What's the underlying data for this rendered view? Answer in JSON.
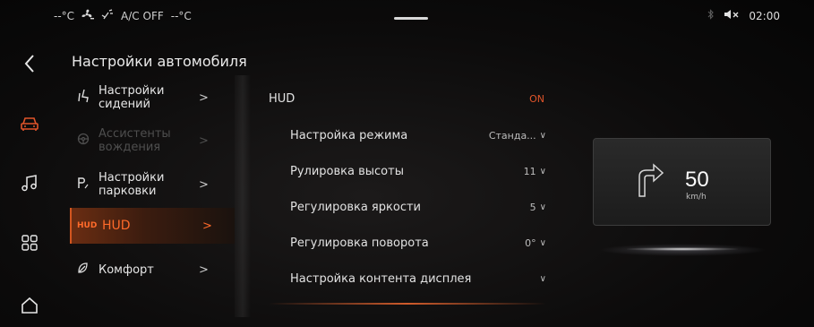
{
  "status_bar": {
    "temp_left": "--°C",
    "fan_icon": "fan-icon",
    "airflow_icon": "airflow-icon",
    "ac_label": "A/C OFF",
    "temp_right": "--°C",
    "bluetooth_icon": "bluetooth-icon",
    "mute_icon": "volume-mute-icon",
    "time": "02:00"
  },
  "nav": {
    "back_icon": "back-arrow-icon",
    "items": [
      {
        "icon": "car-icon",
        "active": true
      },
      {
        "icon": "music-icon",
        "active": false
      },
      {
        "icon": "apps-grid-icon",
        "active": false
      },
      {
        "icon": "home-icon",
        "active": false
      }
    ]
  },
  "page": {
    "title": "Настройки автомобиля"
  },
  "categories": [
    {
      "icon": "seat-icon",
      "label": "Настройки сидений",
      "chevron": ">",
      "state": "normal"
    },
    {
      "icon": "steering-wheel-icon",
      "label": "Ассистенты вождения",
      "chevron": ">",
      "state": "disabled"
    },
    {
      "icon": "parking-icon",
      "label": "Настройки парковки",
      "chevron": ">",
      "state": "normal"
    },
    {
      "icon": "hud-icon",
      "icon_text": "HUD",
      "label": "HUD",
      "chevron": ">",
      "state": "active"
    },
    {
      "icon": "comfort-icon",
      "label": "Комфорт",
      "chevron": ">",
      "state": "normal"
    }
  ],
  "settings": {
    "hud": {
      "label": "HUD",
      "value": "ON"
    },
    "rows": [
      {
        "label": "Настройка режима",
        "value": "Станда...",
        "chevron": "∨"
      },
      {
        "label": "Рулировка высоты",
        "value": "11",
        "chevron": "∨"
      },
      {
        "label": "Регулировка яркости",
        "value": "5",
        "chevron": "∨"
      },
      {
        "label": "Регулировка поворота",
        "value": "0°",
        "chevron": "∨"
      },
      {
        "label": "Настройка контента дисплея",
        "value": "",
        "chevron": "∨"
      }
    ]
  },
  "hud_preview": {
    "speed": "50",
    "unit": "km/h",
    "arrow_icon": "turn-right-arrow-icon"
  },
  "colors": {
    "accent": "#ff6a2a",
    "toggle_on": "#e0542a",
    "background": "#0c0b0b"
  }
}
